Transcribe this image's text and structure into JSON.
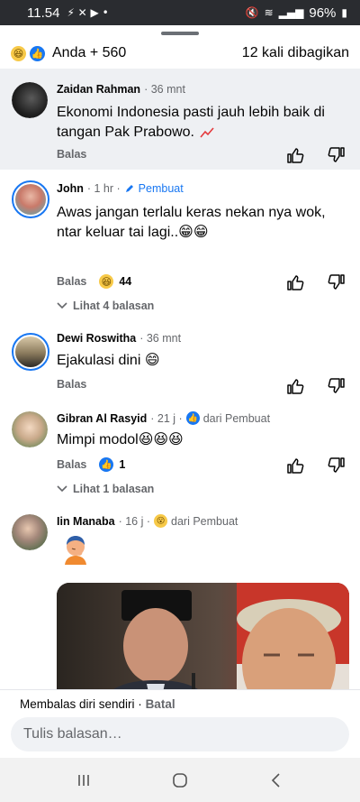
{
  "status_bar": {
    "time": "11.54",
    "battery": "96%"
  },
  "reactions_summary": {
    "text": "Anda + 560",
    "shares": "12 kali dibagikan"
  },
  "comments": [
    {
      "name": "Zaidan Rahman",
      "time": "· 36 mnt",
      "text": "Ekonomi Indonesia pasti jauh lebih baik di tangan Pak Prabowo.",
      "reply_label": "Balas"
    },
    {
      "name": "John",
      "time": "· 1 hr ·",
      "creator_label": "Pembuat",
      "text": "Awas jangan terlalu keras nekan nya wok, ntar keluar tai lagi..😁😁",
      "reply_label": "Balas",
      "reaction_count": "44",
      "view_replies": "Lihat 4 balasan"
    },
    {
      "name": "Dewi Roswitha",
      "time": "· 36 mnt",
      "text": "Ejakulasi dini 😄",
      "reply_label": "Balas"
    },
    {
      "name": "Gibran Al Rasyid",
      "time": "· 21 j ·",
      "from_creator": "dari Pembuat",
      "text": "Mimpi modol😆😆😆",
      "reply_label": "Balas",
      "reaction_count": "1",
      "view_replies": "Lihat 1 balasan"
    },
    {
      "name": "Iin Manaba",
      "time": "· 16 j ·",
      "from_creator": "dari Pembuat"
    }
  ],
  "reply_bar": {
    "status": "Membalas diri sendiri ·",
    "cancel": "Batal",
    "placeholder": "Tulis balasan…"
  },
  "colors": {
    "accent": "#1877f2",
    "secondary_text": "#65676b",
    "highlight_bg": "#eef0f3"
  }
}
